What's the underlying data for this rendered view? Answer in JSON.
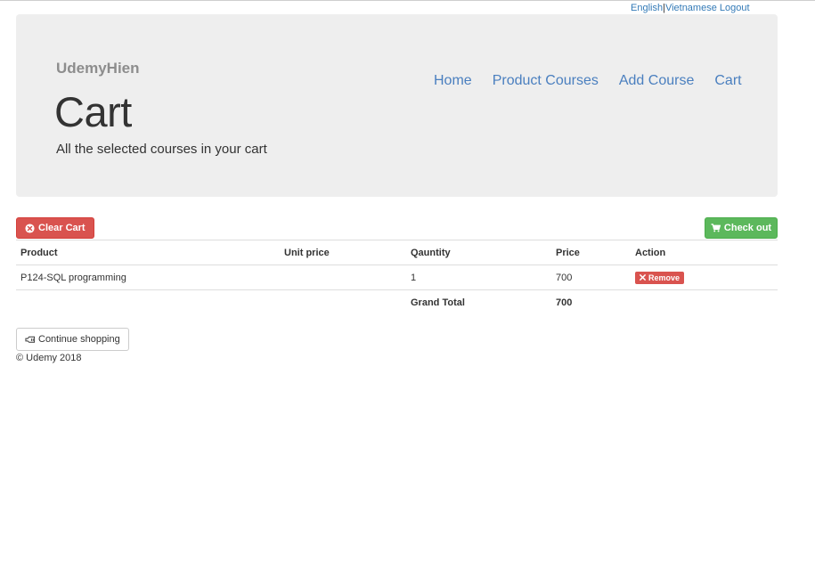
{
  "lang": {
    "english": "English",
    "separator": "|",
    "vietnamese": "Vietnamese",
    "logout": "Logout"
  },
  "header": {
    "brand": "UdemyHien",
    "title": "Cart",
    "subtitle": "All the selected courses in your cart"
  },
  "nav": {
    "items": [
      {
        "label": "Home"
      },
      {
        "label": "Product Courses"
      },
      {
        "label": "Add Course"
      },
      {
        "label": "Cart"
      }
    ]
  },
  "actions": {
    "clear_label": "Clear Cart",
    "checkout_label": "Check out",
    "clear_icon": "remove-circle-icon",
    "checkout_icon": "shopping-cart-icon"
  },
  "table": {
    "headers": [
      "Product",
      "Unit price",
      "Qauntity",
      "Price",
      "Action"
    ],
    "rows": [
      {
        "product": "P124-SQL programming",
        "unit_price": "",
        "quantity": "1",
        "price": "700",
        "action": "Remove"
      }
    ],
    "total_label": "Grand Total",
    "total_value": "700"
  },
  "continue": {
    "label": "Continue shopping",
    "icon": "hand-left-icon"
  },
  "footer": {
    "text": "© Udemy 2018"
  },
  "colors": {
    "danger": "#d9534f",
    "success": "#5cb85c",
    "link": "#4a7fbf",
    "jumbotron": "#eeeeee"
  }
}
